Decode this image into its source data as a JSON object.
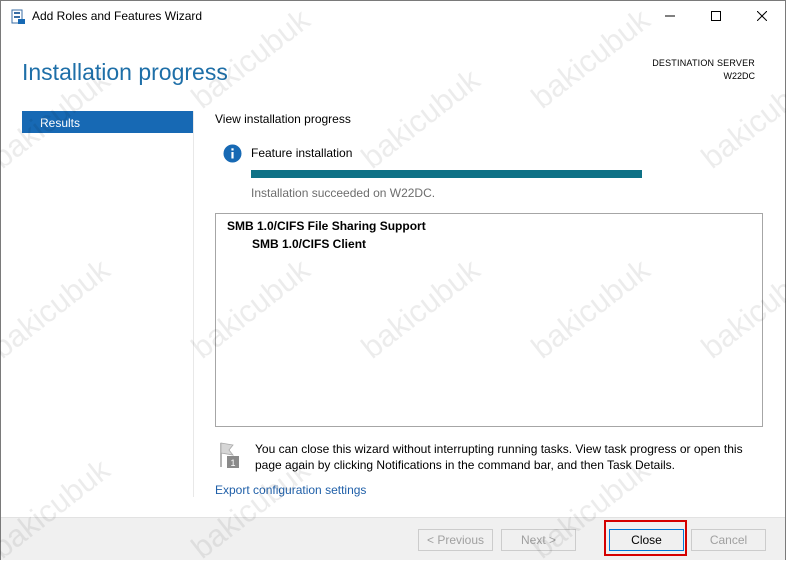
{
  "window": {
    "title": "Add Roles and Features Wizard",
    "icon": "server-manager-icon"
  },
  "titlebar_controls": {
    "minimize_icon": "minimize-icon",
    "maximize_icon": "maximize-icon",
    "close_icon": "close-icon"
  },
  "page": {
    "heading": "Installation progress",
    "destination_label": "DESTINATION SERVER",
    "destination_server": "W22DC"
  },
  "nav": {
    "items": [
      {
        "label": "Results",
        "selected": true
      }
    ]
  },
  "main": {
    "section_title": "View installation progress",
    "feature_label": "Feature installation",
    "progress_percent": 100,
    "status": "Installation succeeded on W22DC.",
    "results": [
      {
        "label": "SMB 1.0/CIFS File Sharing Support",
        "level": 0
      },
      {
        "label": "SMB 1.0/CIFS Client",
        "level": 1
      }
    ],
    "note": "You can close this wizard without interrupting running tasks. View task progress or open this page again by clicking Notifications in the command bar, and then Task Details.",
    "export_link": "Export configuration settings"
  },
  "footer": {
    "previous": "< Previous",
    "next": "Next >",
    "close": "Close",
    "cancel": "Cancel"
  },
  "watermark": "bakicubuk",
  "colors": {
    "accent": "#1769b4",
    "heading": "#1e6fa8",
    "progress": "#0e7186",
    "highlight": "#d40000"
  }
}
